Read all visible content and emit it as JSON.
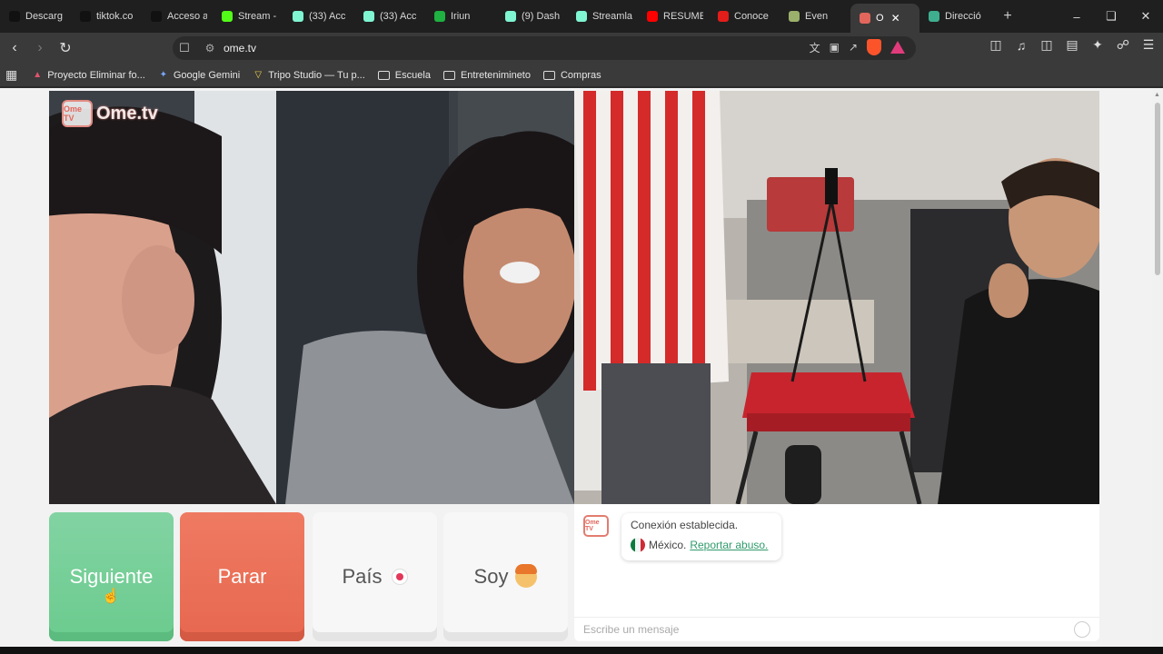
{
  "tabs": [
    {
      "title": "Descarg",
      "icon": "tiktok-icon",
      "color": "#111111"
    },
    {
      "title": "tiktok.co",
      "icon": "tiktok-icon",
      "color": "#111111"
    },
    {
      "title": "Acceso a",
      "icon": "tiktok-icon",
      "color": "#111111"
    },
    {
      "title": "Stream -",
      "icon": "kick-icon",
      "color": "#53fc18"
    },
    {
      "title": "(33) Acc",
      "icon": "streamlabs-icon",
      "color": "#80f5d2"
    },
    {
      "title": "(33) Acc",
      "icon": "streamlabs-icon",
      "color": "#80f5d2"
    },
    {
      "title": "Iriun",
      "icon": "dot-icon",
      "color": "#1fb141"
    },
    {
      "title": "(9) Dash",
      "icon": "streamlabs-icon",
      "color": "#80f5d2"
    },
    {
      "title": "Streamla",
      "icon": "streamlabs-icon",
      "color": "#80f5d2"
    },
    {
      "title": "RESUME",
      "icon": "youtube-icon",
      "color": "#ff0000"
    },
    {
      "title": "Conoce",
      "icon": "telcel-icon",
      "color": "#e31d1a"
    },
    {
      "title": "Even",
      "icon": "soccer-icon",
      "color": "#9bb06b"
    },
    {
      "title": "O",
      "icon": "ometv-icon",
      "color": "#e2665c",
      "active": true
    },
    {
      "title": "Direcció",
      "icon": "web-icon",
      "color": "#3fae8f"
    }
  ],
  "address": {
    "url": "ome.tv"
  },
  "bookmarks": [
    {
      "label": "Proyecto Eliminar fo...",
      "icon": "triangle-icon"
    },
    {
      "label": "Google Gemini",
      "icon": "gemini-icon"
    },
    {
      "label": "Tripo Studio — Tu p...",
      "icon": "tripo-icon"
    },
    {
      "label": "Escuela",
      "icon": "folder-icon"
    },
    {
      "label": "Entretenimineto",
      "icon": "folder-icon"
    },
    {
      "label": "Compras",
      "icon": "folder-icon"
    }
  ],
  "page": {
    "logo_text": "Ome.tv",
    "logo_badge": "Ome TV",
    "buttons": {
      "next": "Siguiente",
      "stop": "Parar",
      "country": "País",
      "soy": "Soy"
    },
    "chat": {
      "status": "Conexión establecida.",
      "country": "México.",
      "report_link": "Reportar abuso.",
      "input_placeholder": "Escribe un mensaje"
    }
  },
  "colors": {
    "next": "#6bcb8e",
    "stop": "#e7674f",
    "accent_link": "#2f9a6b"
  }
}
